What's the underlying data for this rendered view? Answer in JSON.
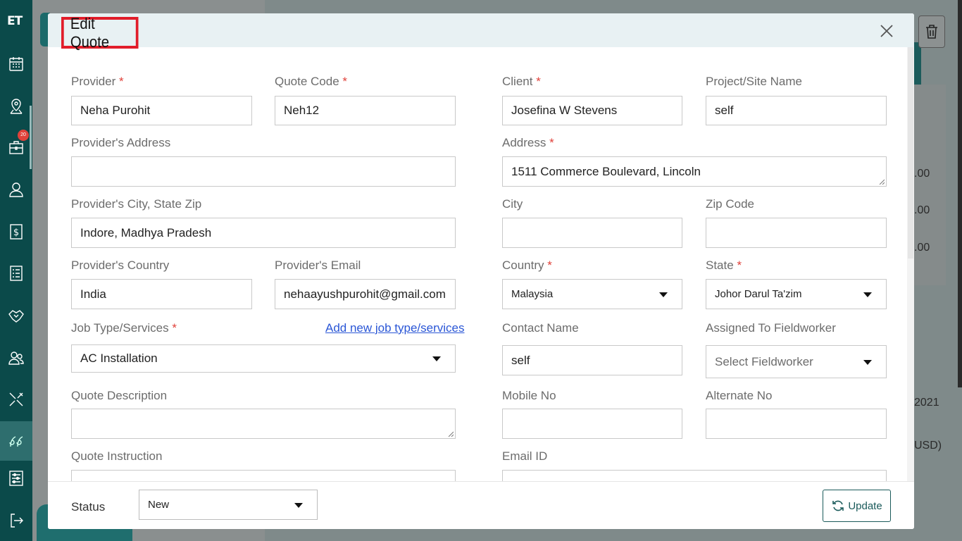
{
  "app": {
    "logo_text": "ET"
  },
  "sidebar": {
    "badge": "20",
    "items": [
      {
        "icon": "calendar-icon"
      },
      {
        "icon": "map-pin-icon"
      },
      {
        "icon": "briefcase-icon"
      },
      {
        "icon": "user-icon"
      },
      {
        "icon": "dollar-icon"
      },
      {
        "icon": "list-icon"
      },
      {
        "icon": "handshake-icon"
      },
      {
        "icon": "users-icon"
      },
      {
        "icon": "tools-icon"
      },
      {
        "icon": "quote-icon"
      },
      {
        "icon": "settings-sliders-icon"
      },
      {
        "icon": "logout-icon"
      }
    ]
  },
  "background": {
    "values": [
      ".00",
      ".00",
      ".00"
    ],
    "year_text": "2021",
    "currency_text": "USD)"
  },
  "modal": {
    "title": "Edit Quote",
    "fields": {
      "provider": {
        "label": "Provider",
        "value": "Neha Purohit"
      },
      "quote_code": {
        "label": "Quote Code",
        "value": "Neh12"
      },
      "client": {
        "label": "Client",
        "value": "Josefina W Stevens"
      },
      "project_site": {
        "label": "Project/Site Name",
        "value": "self"
      },
      "provider_address": {
        "label": "Provider's Address",
        "value": ""
      },
      "address": {
        "label": "Address",
        "value": "1511  Commerce Boulevard, Lincoln"
      },
      "provider_city": {
        "label": "Provider's City, State Zip",
        "value": "Indore, Madhya Pradesh"
      },
      "city": {
        "label": "City",
        "value": ""
      },
      "zip": {
        "label": "Zip Code",
        "value": ""
      },
      "provider_country": {
        "label": "Provider's Country",
        "value": "India"
      },
      "provider_email": {
        "label": "Provider's Email",
        "value": "nehaayushpurohit@gmail.com"
      },
      "country": {
        "label": "Country",
        "value": "Malaysia"
      },
      "state": {
        "label": "State",
        "value": "Johor Darul Ta'zim"
      },
      "job_type": {
        "label": "Job Type/Services",
        "value": "AC Installation",
        "add_link": "Add new job type/services"
      },
      "contact_name": {
        "label": "Contact Name",
        "value": "self"
      },
      "assigned_to": {
        "label": "Assigned To Fieldworker",
        "placeholder": "Select Fieldworker"
      },
      "quote_description": {
        "label": "Quote Description",
        "value": ""
      },
      "mobile": {
        "label": "Mobile No",
        "value": ""
      },
      "alternate": {
        "label": "Alternate No",
        "value": ""
      },
      "quote_instruction": {
        "label": "Quote Instruction",
        "value": ""
      },
      "email_id": {
        "label": "Email ID",
        "value": ""
      }
    },
    "required_mark": "*",
    "footer": {
      "status_label": "Status",
      "status_value": "New",
      "update_label": "Update"
    }
  }
}
